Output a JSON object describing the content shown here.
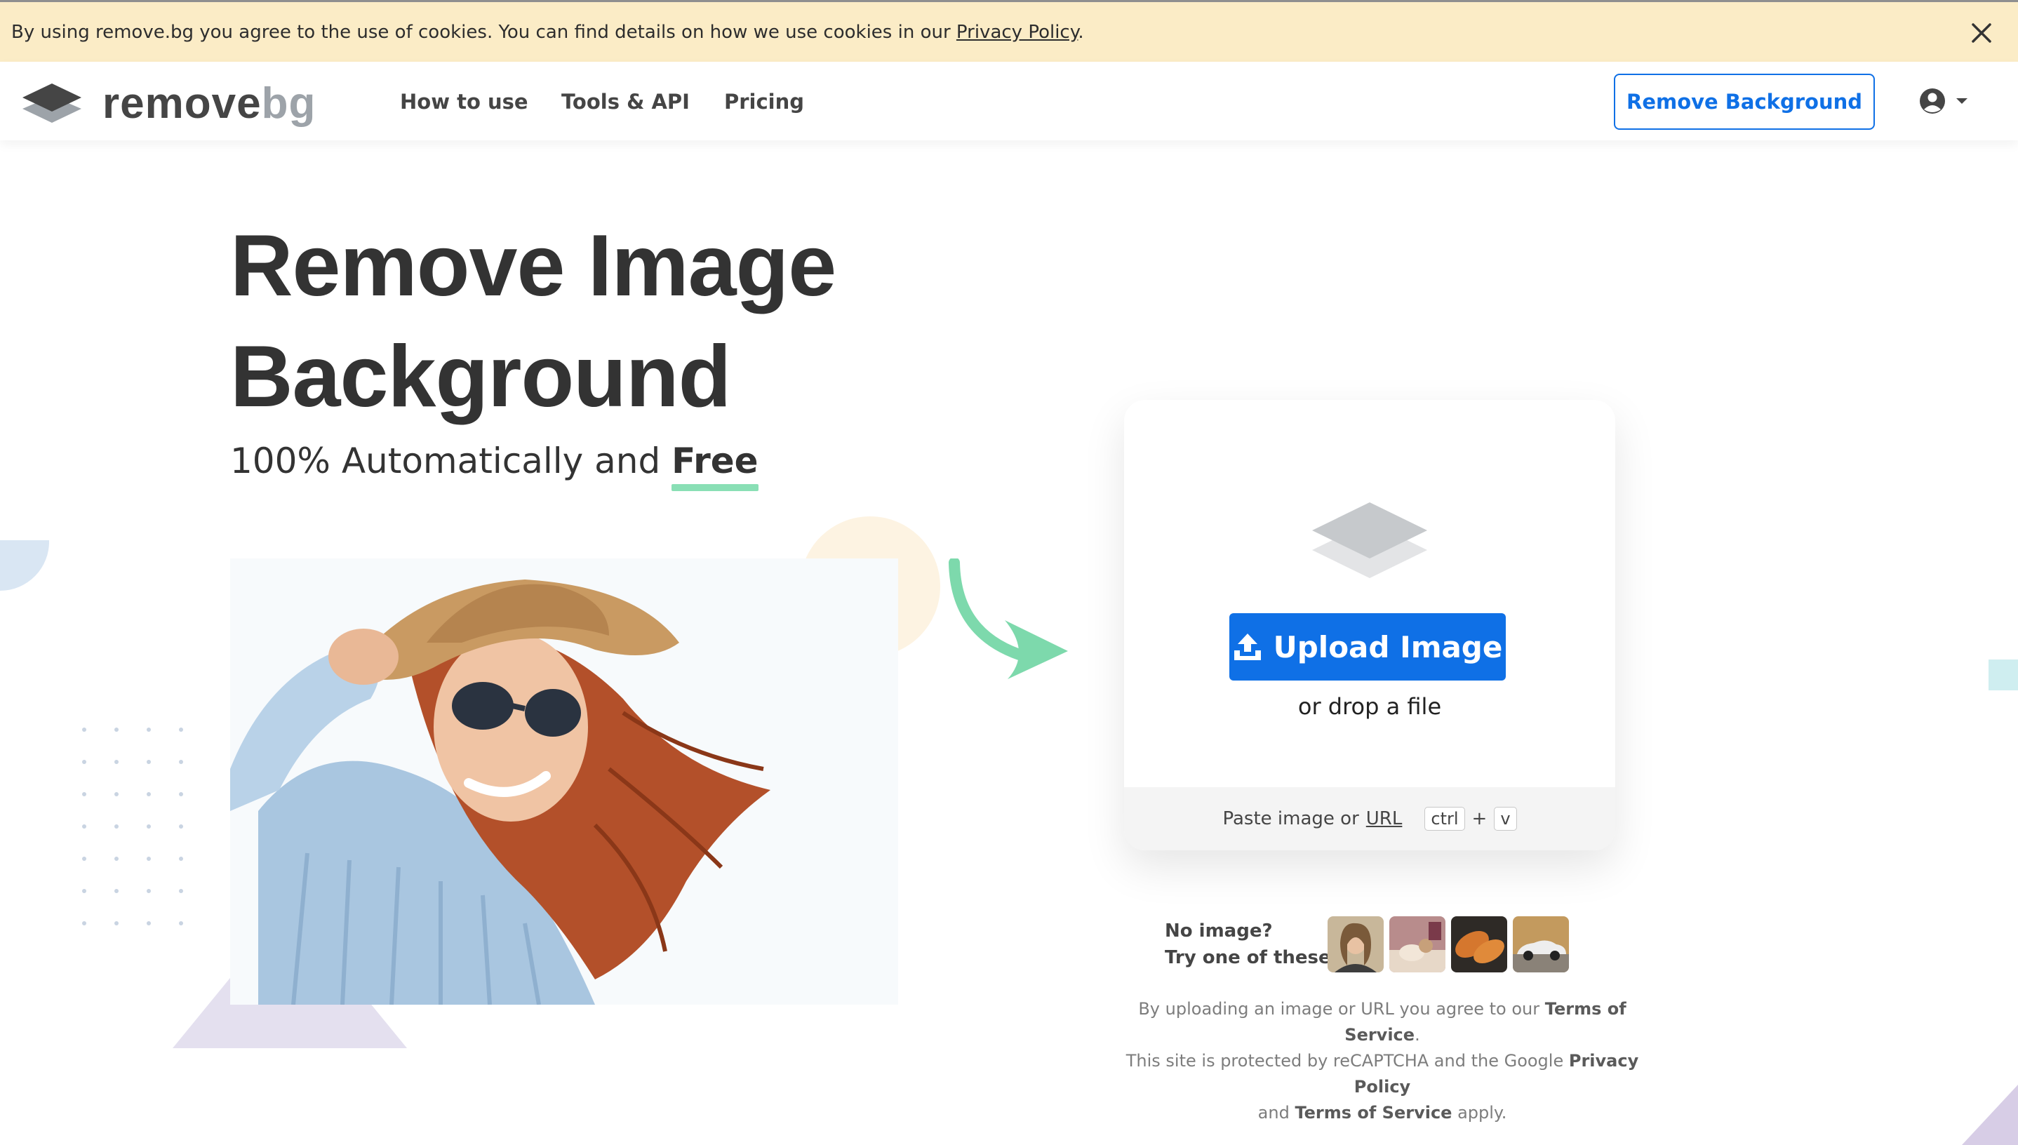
{
  "cookie_banner": {
    "text": "By using remove.bg you agree to the use of cookies. You can find details on how we use cookies in our ",
    "link": "Privacy Policy",
    "suffix": "."
  },
  "nav": {
    "logo_part1": "remove",
    "logo_part2": "bg",
    "links": [
      "How to use",
      "Tools & API",
      "Pricing"
    ],
    "cta": "Remove Background"
  },
  "hero": {
    "title_line1": "Remove Image",
    "title_line2": "Background",
    "subtitle_prefix": "100% Automatically and ",
    "subtitle_emphasis": "Free"
  },
  "upload": {
    "button": "Upload Image",
    "drop": "or drop a file",
    "paste_prefix": "Paste image or",
    "paste_link": "URL",
    "key1": "ctrl",
    "plus": "+",
    "key2": "v"
  },
  "samples": {
    "line1": "No image?",
    "line2": "Try one of these:"
  },
  "legal": {
    "l1_prefix": "By uploading an image or URL you agree to our ",
    "tos": "Terms of Service",
    "l1_suffix": ".",
    "l2_prefix": "This site is protected by reCAPTCHA and the Google ",
    "privacy": "Privacy Policy",
    "l3_prefix": "and ",
    "tos2": "Terms of Service",
    "l3_suffix": " apply."
  },
  "colors": {
    "accent": "#0f70e6",
    "banner": "#fbecc6",
    "underline": "#89dfb5",
    "arrow": "#7dd9ac"
  },
  "icons": [
    "close-icon",
    "layers-logo-icon",
    "user-circle-icon",
    "caret-down-icon",
    "upload-icon",
    "layers-icon",
    "green-arrow-icon"
  ]
}
